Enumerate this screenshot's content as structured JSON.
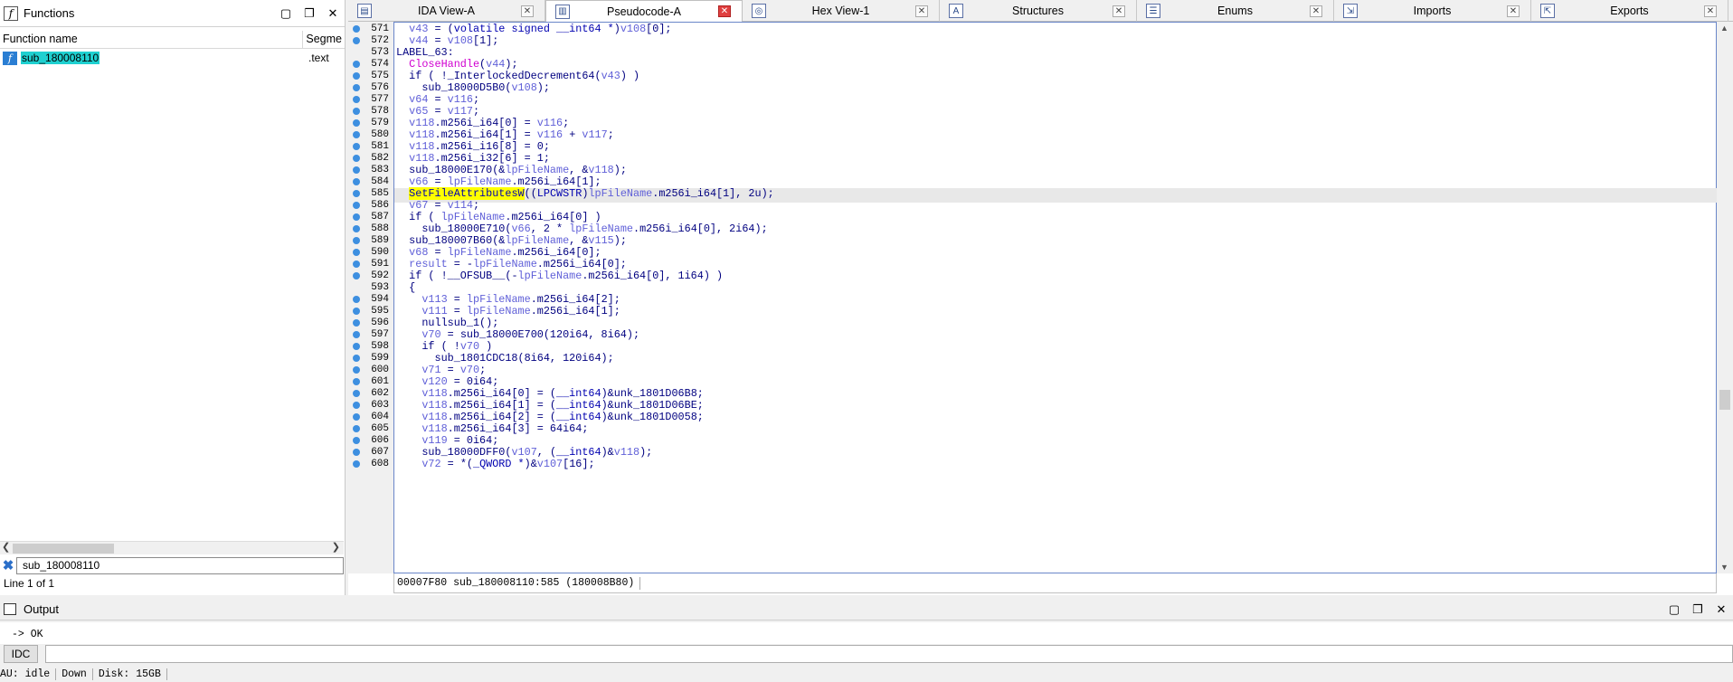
{
  "functions_panel": {
    "title": "Functions",
    "col_name": "Function name",
    "col_segment": "Segme",
    "row_name": "sub_180008110",
    "row_segment": ".text",
    "search_value": "sub_180008110",
    "line_count": "Line 1 of 1"
  },
  "tabs": [
    {
      "label": "IDA View-A",
      "icon": "graph-icon"
    },
    {
      "label": "Pseudocode-A",
      "icon": "document-icon"
    },
    {
      "label": "Hex View-1",
      "icon": "hex-icon"
    },
    {
      "label": "Structures",
      "icon": "structure-icon"
    },
    {
      "label": "Enums",
      "icon": "enum-icon"
    },
    {
      "label": "Imports",
      "icon": "imports-icon"
    },
    {
      "label": "Exports",
      "icon": "exports-icon"
    }
  ],
  "active_tab": 1,
  "code_lines": [
    {
      "n": "571",
      "d": 1,
      "t": [
        [
          "  ",
          ""
        ],
        [
          "v43",
          "v"
        ],
        [
          " = (",
          "c"
        ],
        [
          "volatile signed __int64 *",
          "n"
        ],
        [
          ")",
          "c"
        ],
        [
          "v108",
          "v"
        ],
        [
          "[0];",
          "c"
        ]
      ]
    },
    {
      "n": "572",
      "d": 1,
      "t": [
        [
          "  ",
          ""
        ],
        [
          "v44",
          "v"
        ],
        [
          " = ",
          "c"
        ],
        [
          "v108",
          "v"
        ],
        [
          "[1];",
          "c"
        ]
      ]
    },
    {
      "n": "573",
      "d": 0,
      "t": [
        [
          "LABEL_63:",
          "c"
        ]
      ]
    },
    {
      "n": "574",
      "d": 1,
      "t": [
        [
          "  ",
          ""
        ],
        [
          "CloseHandle",
          "f"
        ],
        [
          "(",
          "c"
        ],
        [
          "v44",
          "v"
        ],
        [
          ");",
          "c"
        ]
      ]
    },
    {
      "n": "575",
      "d": 1,
      "t": [
        [
          "  ",
          ""
        ],
        [
          "if ( !_InterlockedDecrement64(",
          "c"
        ],
        [
          "v43",
          "v"
        ],
        [
          ") )",
          "c"
        ]
      ]
    },
    {
      "n": "576",
      "d": 1,
      "t": [
        [
          "    ",
          ""
        ],
        [
          "sub_18000D5B0(",
          "c"
        ],
        [
          "v108",
          "v"
        ],
        [
          ");",
          "c"
        ]
      ]
    },
    {
      "n": "577",
      "d": 1,
      "t": [
        [
          "  ",
          ""
        ],
        [
          "v64",
          "v"
        ],
        [
          " = ",
          "c"
        ],
        [
          "v116",
          "v"
        ],
        [
          ";",
          "c"
        ]
      ]
    },
    {
      "n": "578",
      "d": 1,
      "t": [
        [
          "  ",
          ""
        ],
        [
          "v65",
          "v"
        ],
        [
          " = ",
          "c"
        ],
        [
          "v117",
          "v"
        ],
        [
          ";",
          "c"
        ]
      ]
    },
    {
      "n": "579",
      "d": 1,
      "t": [
        [
          "  ",
          ""
        ],
        [
          "v118",
          "v"
        ],
        [
          ".m256i_i64[0] = ",
          "c"
        ],
        [
          "v116",
          "v"
        ],
        [
          ";",
          "c"
        ]
      ]
    },
    {
      "n": "580",
      "d": 1,
      "t": [
        [
          "  ",
          ""
        ],
        [
          "v118",
          "v"
        ],
        [
          ".m256i_i64[1] = ",
          "c"
        ],
        [
          "v116",
          "v"
        ],
        [
          " + ",
          "c"
        ],
        [
          "v117",
          "v"
        ],
        [
          ";",
          "c"
        ]
      ]
    },
    {
      "n": "581",
      "d": 1,
      "t": [
        [
          "  ",
          ""
        ],
        [
          "v118",
          "v"
        ],
        [
          ".m256i_i16[8] = 0;",
          "c"
        ]
      ]
    },
    {
      "n": "582",
      "d": 1,
      "t": [
        [
          "  ",
          ""
        ],
        [
          "v118",
          "v"
        ],
        [
          ".m256i_i32[6] = 1;",
          "c"
        ]
      ]
    },
    {
      "n": "583",
      "d": 1,
      "t": [
        [
          "  ",
          ""
        ],
        [
          "sub_18000E170(&",
          "c"
        ],
        [
          "lpFileName",
          "v"
        ],
        [
          ", &",
          "c"
        ],
        [
          "v118",
          "v"
        ],
        [
          ");",
          "c"
        ]
      ]
    },
    {
      "n": "584",
      "d": 1,
      "t": [
        [
          "  ",
          ""
        ],
        [
          "v66",
          "v"
        ],
        [
          " = ",
          "c"
        ],
        [
          "lpFileName",
          "v"
        ],
        [
          ".m256i_i64[1];",
          "c"
        ]
      ]
    },
    {
      "n": "585",
      "d": 1,
      "h": 1,
      "t": [
        [
          "  ",
          ""
        ],
        [
          "SetFileAttributesW",
          "hlw"
        ],
        [
          "((",
          "c"
        ],
        [
          "LPCWSTR",
          "n"
        ],
        [
          ")",
          "c"
        ],
        [
          "lpFileName",
          "v"
        ],
        [
          ".m256i_i64[1], 2u);",
          "c"
        ]
      ]
    },
    {
      "n": "586",
      "d": 1,
      "t": [
        [
          "  ",
          ""
        ],
        [
          "v67",
          "v"
        ],
        [
          " = ",
          "c"
        ],
        [
          "v114",
          "v"
        ],
        [
          ";",
          "c"
        ]
      ]
    },
    {
      "n": "587",
      "d": 1,
      "t": [
        [
          "  ",
          ""
        ],
        [
          "if ( ",
          "c"
        ],
        [
          "lpFileName",
          "v"
        ],
        [
          ".m256i_i64[0] )",
          "c"
        ]
      ]
    },
    {
      "n": "588",
      "d": 1,
      "t": [
        [
          "    ",
          ""
        ],
        [
          "sub_18000E710(",
          "c"
        ],
        [
          "v66",
          "v"
        ],
        [
          ", 2 * ",
          "c"
        ],
        [
          "lpFileName",
          "v"
        ],
        [
          ".m256i_i64[0], 2i64);",
          "c"
        ]
      ]
    },
    {
      "n": "589",
      "d": 1,
      "t": [
        [
          "  ",
          ""
        ],
        [
          "sub_180007B60(&",
          "c"
        ],
        [
          "lpFileName",
          "v"
        ],
        [
          ", &",
          "c"
        ],
        [
          "v115",
          "v"
        ],
        [
          ");",
          "c"
        ]
      ]
    },
    {
      "n": "590",
      "d": 1,
      "t": [
        [
          "  ",
          ""
        ],
        [
          "v68",
          "v"
        ],
        [
          " = ",
          "c"
        ],
        [
          "lpFileName",
          "v"
        ],
        [
          ".m256i_i64[0];",
          "c"
        ]
      ]
    },
    {
      "n": "591",
      "d": 1,
      "t": [
        [
          "  ",
          ""
        ],
        [
          "result",
          "v"
        ],
        [
          " = -",
          "c"
        ],
        [
          "lpFileName",
          "v"
        ],
        [
          ".m256i_i64[0];",
          "c"
        ]
      ]
    },
    {
      "n": "592",
      "d": 1,
      "t": [
        [
          "  ",
          ""
        ],
        [
          "if ( !__OFSUB__(-",
          "c"
        ],
        [
          "lpFileName",
          "v"
        ],
        [
          ".m256i_i64[0], 1i64) )",
          "c"
        ]
      ]
    },
    {
      "n": "593",
      "d": 0,
      "t": [
        [
          "  {",
          "c"
        ]
      ]
    },
    {
      "n": "594",
      "d": 1,
      "t": [
        [
          "    ",
          ""
        ],
        [
          "v113",
          "v"
        ],
        [
          " = ",
          "c"
        ],
        [
          "lpFileName",
          "v"
        ],
        [
          ".m256i_i64[2];",
          "c"
        ]
      ]
    },
    {
      "n": "595",
      "d": 1,
      "t": [
        [
          "    ",
          ""
        ],
        [
          "v111",
          "v"
        ],
        [
          " = ",
          "c"
        ],
        [
          "lpFileName",
          "v"
        ],
        [
          ".m256i_i64[1];",
          "c"
        ]
      ]
    },
    {
      "n": "596",
      "d": 1,
      "t": [
        [
          "    ",
          ""
        ],
        [
          "nullsub_1();",
          "c"
        ]
      ]
    },
    {
      "n": "597",
      "d": 1,
      "t": [
        [
          "    ",
          ""
        ],
        [
          "v70",
          "v"
        ],
        [
          " = sub_18000E700(120i64, 8i64);",
          "c"
        ]
      ]
    },
    {
      "n": "598",
      "d": 1,
      "t": [
        [
          "    ",
          ""
        ],
        [
          "if ( !",
          "c"
        ],
        [
          "v70",
          "v"
        ],
        [
          " )",
          "c"
        ]
      ]
    },
    {
      "n": "599",
      "d": 1,
      "t": [
        [
          "      ",
          ""
        ],
        [
          "sub_1801CDC18(8i64, 120i64);",
          "c"
        ]
      ]
    },
    {
      "n": "600",
      "d": 1,
      "t": [
        [
          "    ",
          ""
        ],
        [
          "v71",
          "v"
        ],
        [
          " = ",
          "c"
        ],
        [
          "v70",
          "v"
        ],
        [
          ";",
          "c"
        ]
      ]
    },
    {
      "n": "601",
      "d": 1,
      "t": [
        [
          "    ",
          ""
        ],
        [
          "v120",
          "v"
        ],
        [
          " = 0i64;",
          "c"
        ]
      ]
    },
    {
      "n": "602",
      "d": 1,
      "t": [
        [
          "    ",
          ""
        ],
        [
          "v118",
          "v"
        ],
        [
          ".m256i_i64[0] = (",
          "c"
        ],
        [
          "__int64",
          "n"
        ],
        [
          ")&unk_1801D06B8;",
          "c"
        ]
      ]
    },
    {
      "n": "603",
      "d": 1,
      "t": [
        [
          "    ",
          ""
        ],
        [
          "v118",
          "v"
        ],
        [
          ".m256i_i64[1] = (",
          "c"
        ],
        [
          "__int64",
          "n"
        ],
        [
          ")&unk_1801D06BE;",
          "c"
        ]
      ]
    },
    {
      "n": "604",
      "d": 1,
      "t": [
        [
          "    ",
          ""
        ],
        [
          "v118",
          "v"
        ],
        [
          ".m256i_i64[2] = (",
          "c"
        ],
        [
          "__int64",
          "n"
        ],
        [
          ")&unk_1801D0058;",
          "c"
        ]
      ]
    },
    {
      "n": "605",
      "d": 1,
      "t": [
        [
          "    ",
          ""
        ],
        [
          "v118",
          "v"
        ],
        [
          ".m256i_i64[3] = 64i64;",
          "c"
        ]
      ]
    },
    {
      "n": "606",
      "d": 1,
      "t": [
        [
          "    ",
          ""
        ],
        [
          "v119",
          "v"
        ],
        [
          " = 0i64;",
          "c"
        ]
      ]
    },
    {
      "n": "607",
      "d": 1,
      "t": [
        [
          "    ",
          ""
        ],
        [
          "sub_18000DFF0(",
          "c"
        ],
        [
          "v107",
          "v"
        ],
        [
          ", (",
          "c"
        ],
        [
          "__int64",
          "n"
        ],
        [
          ")&",
          "c"
        ],
        [
          "v118",
          "v"
        ],
        [
          ");",
          "c"
        ]
      ]
    },
    {
      "n": "608",
      "d": 1,
      "t": [
        [
          "    ",
          ""
        ],
        [
          "v72",
          "v"
        ],
        [
          " = *(",
          "c"
        ],
        [
          "_QWORD *",
          "n"
        ],
        [
          ")&",
          "c"
        ],
        [
          "v107",
          "v"
        ],
        [
          "[16];",
          "c"
        ]
      ]
    }
  ],
  "status_line": "00007F80 sub_180008110:585 (180008B80)",
  "output": {
    "title": "Output",
    "text": "  -> OK"
  },
  "cmd_lang": "IDC",
  "bottom": {
    "au": "AU:  idle",
    "dir": "Down",
    "disk": "Disk: 15GB"
  }
}
